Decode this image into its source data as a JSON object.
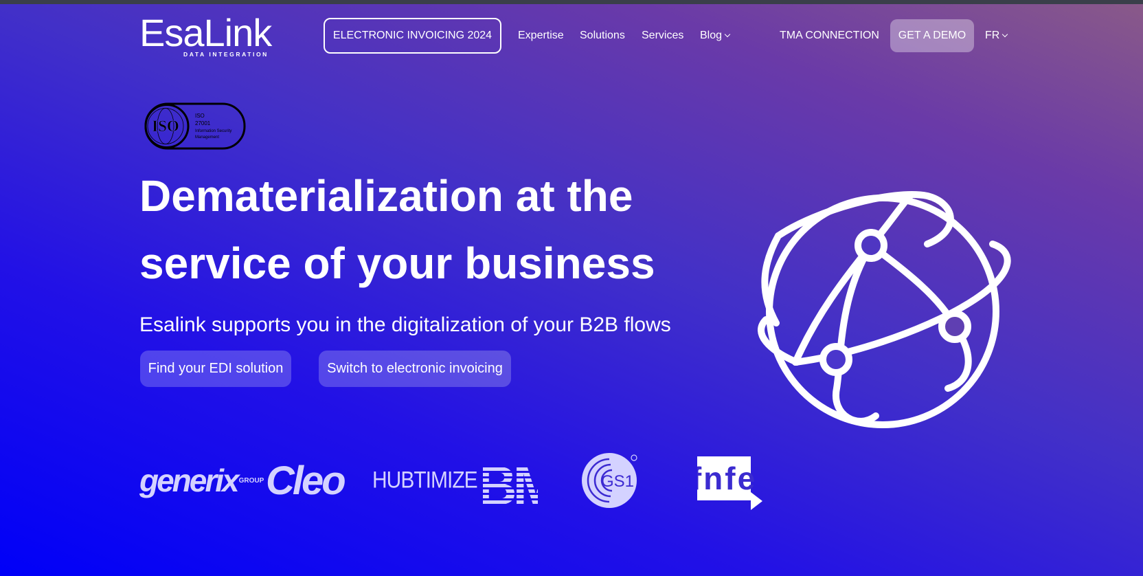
{
  "logo": {
    "name": "EsaLink",
    "tagline": "DATA INTEGRATION"
  },
  "nav": {
    "highlight": "ELECTRONIC INVOICING 2024",
    "items": [
      "Expertise",
      "Solutions",
      "Services",
      "Blog"
    ],
    "tma": "TMA CONNECTION",
    "demo": "GET A DEMO",
    "lang": "FR"
  },
  "badge": {
    "iso": "ISO",
    "line1": "ISO",
    "line2": "27001",
    "line3": "Information Security",
    "line4": "Management"
  },
  "hero": {
    "title_line1": "Dematerialization at the",
    "title_line2": "service of your business",
    "subtitle": "Esalink supports you in the digitalization of your B2B flows",
    "cta_edi": "Find your EDI solution",
    "cta_invoicing": "Switch to electronic invoicing"
  },
  "partners": {
    "generix": "generix",
    "generix_group": "GROUP",
    "cleo": "Cleo",
    "hubtimize": "HUBTIMIZE",
    "ibm": "IBM",
    "gs1": "GS1",
    "fnfe": "fnfe"
  },
  "colors": {
    "gradient_start": "#0000f8",
    "gradient_end": "#8a5a88",
    "text": "#ffffff"
  }
}
